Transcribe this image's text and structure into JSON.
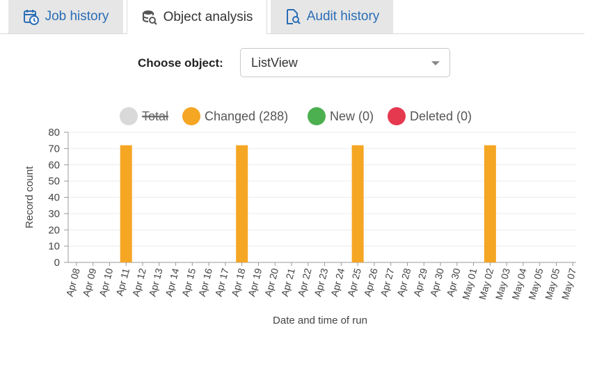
{
  "tabs": [
    {
      "label": "Job history",
      "icon": "calendar-clock-icon",
      "active": false
    },
    {
      "label": "Object analysis",
      "icon": "database-search-icon",
      "active": true
    },
    {
      "label": "Audit history",
      "icon": "document-search-icon",
      "active": false
    }
  ],
  "chooser": {
    "label": "Choose object:",
    "value": "ListView"
  },
  "colors": {
    "changed": "#f5a623",
    "new": "#4caf50",
    "deleted": "#e53950",
    "total": "#d9d9d9",
    "tab_link": "#2a6db5"
  },
  "chart_data": {
    "type": "bar",
    "xlabel": "Date and time of run",
    "ylabel": "Record count",
    "ylim": [
      0,
      80
    ],
    "yticks": [
      0,
      10,
      20,
      30,
      40,
      50,
      60,
      70,
      80
    ],
    "categories": [
      "Apr 08",
      "Apr 09",
      "Apr 10",
      "Apr 11",
      "Apr 12",
      "Apr 13",
      "Apr 14",
      "Apr 15",
      "Apr 16",
      "Apr 17",
      "Apr 18",
      "Apr 19",
      "Apr 20",
      "Apr 21",
      "Apr 22",
      "Apr 23",
      "Apr 24",
      "Apr 25",
      "Apr 26",
      "Apr 27",
      "Apr 28",
      "Apr 29",
      "Apr 30",
      "Apr 30",
      "May 01",
      "May 02",
      "May 03",
      "May 04",
      "May 05",
      "May 05",
      "May 07"
    ],
    "legend": [
      {
        "label": "Total",
        "color": "#d9d9d9",
        "hidden": true
      },
      {
        "label": "Changed (288)",
        "color": "#f5a623",
        "hidden": false
      },
      {
        "label": "New (0)",
        "color": "#4caf50",
        "hidden": false
      },
      {
        "label": "Deleted (0)",
        "color": "#e53950",
        "hidden": false
      }
    ],
    "series": [
      {
        "name": "Changed (288)",
        "color": "#f5a623",
        "values": [
          0,
          0,
          0,
          72,
          0,
          0,
          0,
          0,
          0,
          0,
          72,
          0,
          0,
          0,
          0,
          0,
          0,
          72,
          0,
          0,
          0,
          0,
          0,
          0,
          0,
          72,
          0,
          0,
          0,
          0,
          0
        ]
      }
    ],
    "legend_position": "top-center",
    "grid": true
  }
}
